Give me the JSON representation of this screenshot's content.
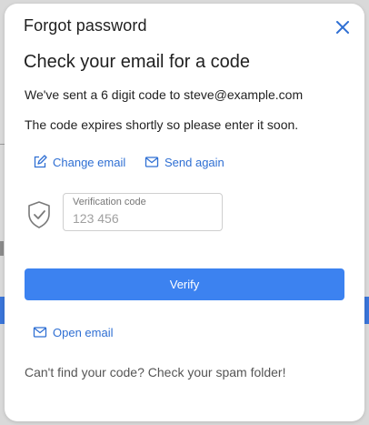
{
  "modal": {
    "title": "Forgot password",
    "heading": "Check your email for a code",
    "sent_text": "We've sent a 6 digit code to steve@example.com",
    "expiry_text": "The code expires shortly so please enter it soon.",
    "change_email_label": "Change email",
    "send_again_label": "Send again",
    "code_field": {
      "label": "Verification code",
      "placeholder": "123 456",
      "value": ""
    },
    "verify_label": "Verify",
    "open_email_label": "Open email",
    "footer_text": "Can't find your code? Check your spam folder!"
  },
  "icons": {
    "close": "close-icon",
    "edit": "edit-icon",
    "mail": "mail-icon",
    "shield": "shield-check-icon"
  },
  "colors": {
    "accent": "#3c82f0",
    "link": "#2f6fd3",
    "text": "#1f1f1f",
    "muted": "#555555"
  }
}
